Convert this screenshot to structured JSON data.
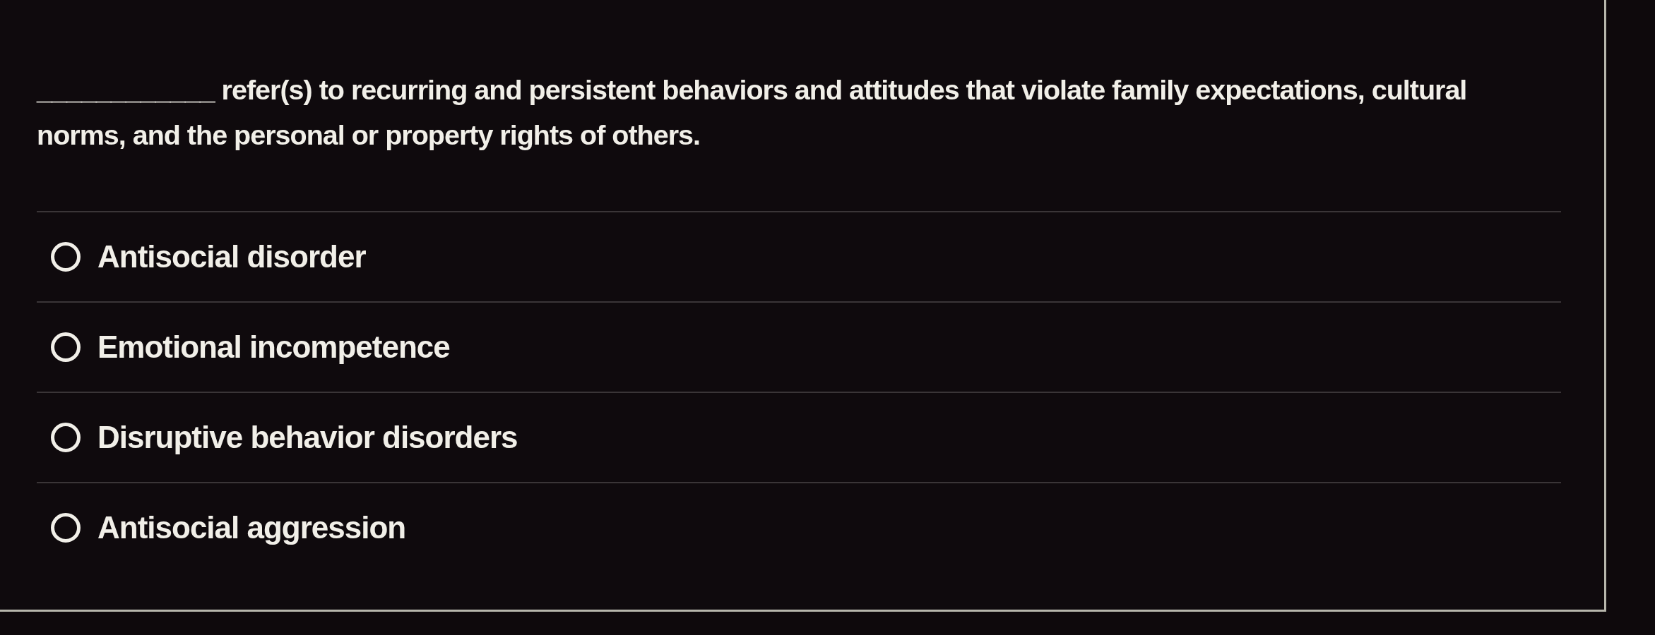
{
  "question": {
    "text": "____________ refer(s) to recurring and persistent behaviors and attitudes that violate family expectations, cultural norms, and the personal or property rights of others."
  },
  "options": [
    {
      "label": "Antisocial disorder",
      "selected": false
    },
    {
      "label": "Emotional incompetence",
      "selected": false
    },
    {
      "label": "Disruptive behavior disorders",
      "selected": false
    },
    {
      "label": "Antisocial aggression",
      "selected": false
    }
  ]
}
